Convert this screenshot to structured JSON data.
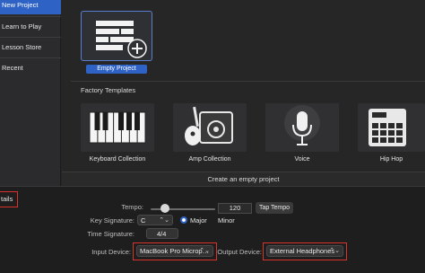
{
  "sidebar": {
    "items": [
      {
        "label": "New Project",
        "selected": true
      },
      {
        "label": "Learn to Play"
      },
      {
        "label": "Lesson Store"
      },
      {
        "label": "Recent"
      }
    ]
  },
  "main": {
    "empty_project_label": "Empty Project",
    "templates_title": "Factory Templates",
    "templates": [
      {
        "label": "Keyboard Collection",
        "icon": "piano-keys-icon"
      },
      {
        "label": "Amp Collection",
        "icon": "guitar-amp-icon"
      },
      {
        "label": "Voice",
        "icon": "microphone-icon"
      },
      {
        "label": "Hip Hop",
        "icon": "drum-machine-icon"
      }
    ],
    "create_hint": "Create an empty project"
  },
  "details": {
    "toggle_label": "tails",
    "tempo_label": "Tempo:",
    "tempo_value": "120",
    "tap_tempo_label": "Tap Tempo",
    "key_signature_label": "Key Signature:",
    "key_value": "C",
    "major_label": "Major",
    "minor_label": "Minor",
    "time_signature_label": "Time Signature:",
    "time_signature_value": "4/4",
    "input_device_label": "Input Device:",
    "input_device_value": "MacBook Pro Microp…",
    "output_device_label": "Output Device:",
    "output_device_value": "External Headphones"
  },
  "colors": {
    "accent": "#2e63c5",
    "highlight_box": "#d9342b"
  }
}
